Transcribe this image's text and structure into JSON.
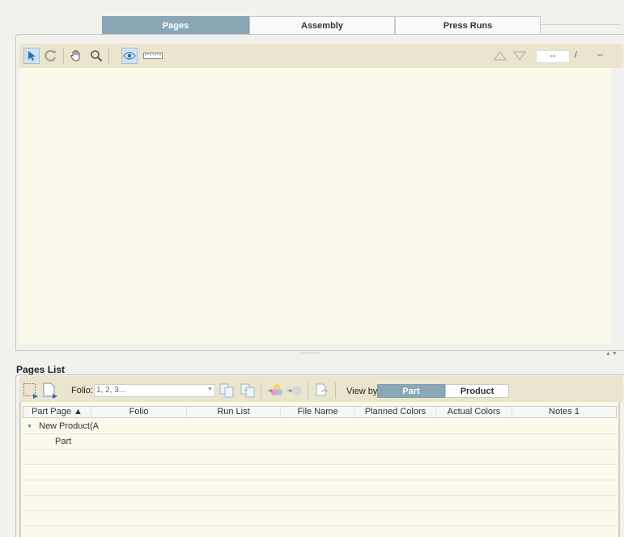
{
  "tabs": [
    "Pages",
    "Assembly",
    "Press Runs"
  ],
  "viewer": {
    "tools": [
      "select-arrow-icon",
      "rotate-icon",
      "hand-pan-icon",
      "magnifier-icon",
      "eye-preview-icon",
      "ruler-icon"
    ],
    "prev_icon": "triangle-up-icon",
    "next_icon": "triangle-down-icon",
    "page_value": "--",
    "separator": "/",
    "page_total": "--"
  },
  "pages_list": {
    "title": "Pages List",
    "folio_label": "Folio:",
    "folio_placeholder": "1, 2, 3...",
    "view_by_label": "View by",
    "view_by_options": [
      "Part",
      "Product"
    ],
    "columns": [
      "Part Page ▲",
      "Folio",
      "Run List",
      "File Name",
      "Planned Colors",
      "Actual Colors",
      "Notes 1"
    ],
    "rows": [
      {
        "label": "New Product(A",
        "level": 0,
        "expanded": true
      },
      {
        "label": "Part",
        "level": 1
      }
    ]
  },
  "colors": {
    "accent": "#89a7b7",
    "toolbar": "#ece5ce",
    "canvas": "#fbf9ea"
  }
}
